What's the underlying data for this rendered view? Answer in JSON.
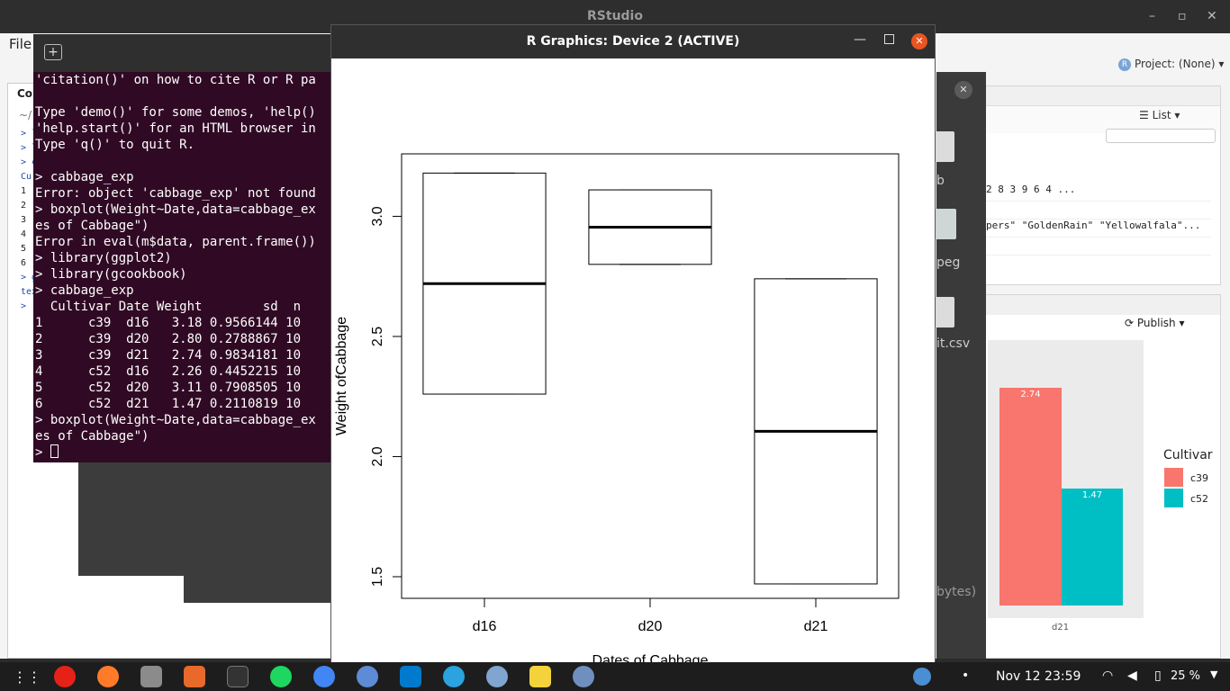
{
  "app": {
    "title": "RStudio",
    "menu_file": "File",
    "project": "Project: (None)"
  },
  "left_pane": {
    "tab": "Co",
    "cwd": "~/",
    "lines": [
      "> li",
      "> li",
      "> ca",
      "  Cu",
      "1",
      "2",
      "3",
      "4",
      "5",
      "6",
      "> gg",
      "text",
      "> |"
    ]
  },
  "console": {
    "lines": [
      "'citation()' on how to cite R or R pa",
      "",
      "Type 'demo()' for some demos, 'help()",
      "'help.start()' for an HTML browser in",
      "Type 'q()' to quit R.",
      "",
      "> cabbage_exp",
      "Error: object 'cabbage_exp' not found",
      "> boxplot(Weight~Date,data=cabbage_ex",
      "es of Cabbage\")",
      "Error in eval(m$data, parent.frame())",
      "> library(ggplot2)",
      "> library(gcookbook)",
      "> cabbage_exp",
      "  Cultivar Date Weight        sd  n",
      "1      c39  d16   3.18 0.9566144 10",
      "2      c39  d20   2.80 0.2788867 10",
      "3      c39  d21   2.74 0.9834181 10",
      "4      c52  d16   2.26 0.4452215 10",
      "5      c52  d20   3.11 0.7908505 10",
      "6      c52  d21   1.47 0.2110819 10",
      "> boxplot(Weight~Date,data=cabbage_ex",
      "es of Cabbage\")",
      "> "
    ]
  },
  "graphics_window": {
    "title": "R Graphics: Device 2 (ACTIVE)"
  },
  "chart_data": [
    {
      "type": "box",
      "title": "",
      "xlabel": "Dates of Cabbage",
      "ylabel": "Weight ofCabbage",
      "categories": [
        "d16",
        "d20",
        "d21"
      ],
      "boxes": [
        {
          "category": "d16",
          "min": 2.26,
          "q1": 2.26,
          "median": 2.72,
          "q3": 3.18,
          "max": 3.18
        },
        {
          "category": "d20",
          "min": 2.8,
          "q1": 2.8,
          "median": 2.955,
          "q3": 3.11,
          "max": 3.11
        },
        {
          "category": "d21",
          "min": 1.47,
          "q1": 1.47,
          "median": 2.105,
          "q3": 2.74,
          "max": 2.74
        }
      ],
      "yticks": [
        "1.5",
        "2.0",
        "2.5",
        "3.0"
      ],
      "ylim": [
        1.41,
        3.26
      ]
    },
    {
      "type": "bar",
      "title": "",
      "xlabel": "",
      "ylabel": "",
      "categories": [
        "d21"
      ],
      "series": [
        {
          "name": "c39",
          "values": [
            2.74
          ],
          "color": "#f8766d"
        },
        {
          "name": "c52",
          "values": [
            1.47
          ],
          "color": "#00bfc4"
        }
      ],
      "legend_title": "Cultivar",
      "legend_position": "right"
    }
  ],
  "env_pane": {
    "list_label": "List",
    "rows": [
      "2 8 3 9 6 4 ...",
      "",
      "pers\" \"GoldenRain\" \"Yellowalfala\"...",
      ""
    ]
  },
  "files_pane": {
    "publish_label": "Publish",
    "bar_labels": [
      "2.74",
      "1.47"
    ],
    "x_tick": "d21"
  },
  "middle_files": {
    "items": [
      "b",
      "peg",
      "it.csv"
    ],
    "bytes": "bytes)"
  },
  "taskbar": {
    "clock": "Nov 12  23:59",
    "battery": "25 %"
  },
  "colors": {
    "console_bg": "#300a24",
    "accent": "#e95420",
    "c39": "#f8766d",
    "c52": "#00bfc4"
  }
}
